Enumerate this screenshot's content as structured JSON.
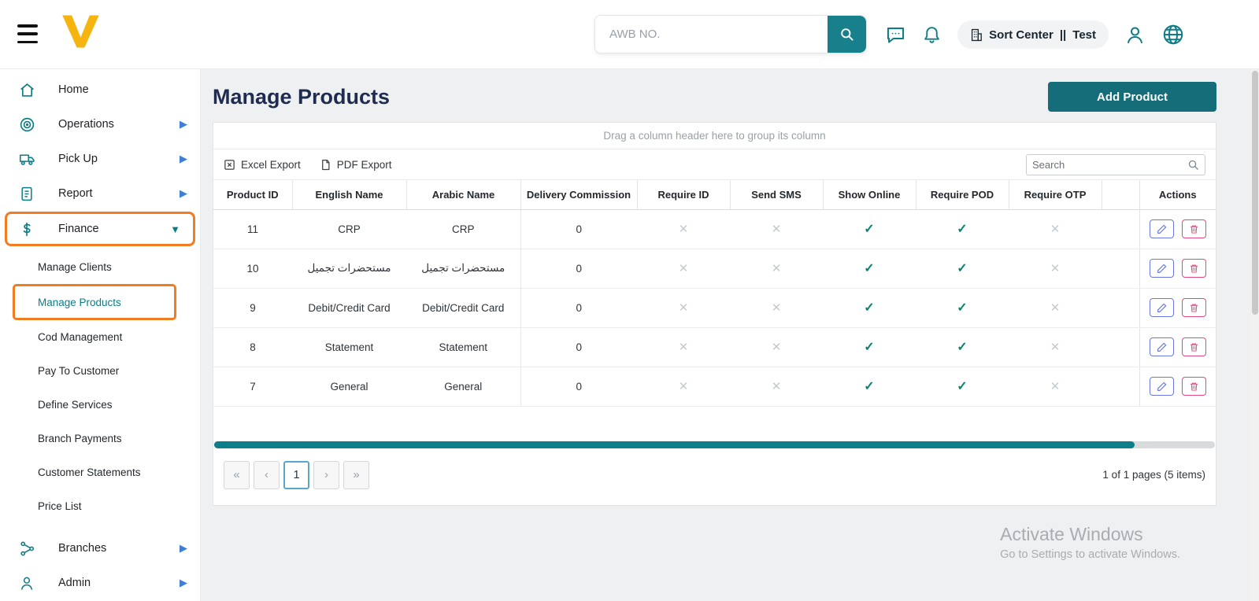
{
  "header": {
    "search": {
      "placeholder": "AWB NO."
    },
    "center_badge": {
      "label": "Sort Center",
      "divider": "||",
      "value": "Test"
    }
  },
  "sidebar": {
    "items": [
      {
        "label": "Home",
        "icon": "home"
      },
      {
        "label": "Operations",
        "icon": "operations"
      },
      {
        "label": "Pick Up",
        "icon": "pickup-truck"
      },
      {
        "label": "Report",
        "icon": "report-document"
      },
      {
        "label": "Finance",
        "icon": "dollar"
      },
      {
        "label": "Branches",
        "icon": "branches-network"
      },
      {
        "label": "Admin",
        "icon": "person"
      }
    ],
    "finance_submenu": [
      {
        "label": "Manage Clients"
      },
      {
        "label": "Manage Products"
      },
      {
        "label": "Cod Management"
      },
      {
        "label": "Pay To Customer"
      },
      {
        "label": "Define Services"
      },
      {
        "label": "Branch Payments"
      },
      {
        "label": "Customer Statements"
      },
      {
        "label": "Price List"
      }
    ]
  },
  "main": {
    "title": "Manage Products",
    "add_product_button": "Add Product",
    "grid": {
      "group_hint": "Drag a column header here to group its column",
      "excel_export_label": "Excel Export",
      "pdf_export_label": "PDF Export",
      "search_placeholder": "Search",
      "columns": [
        "Product ID",
        "English Name",
        "Arabic Name",
        "Delivery Commission",
        "Require ID",
        "Send SMS",
        "Show Online",
        "Require POD",
        "Require OTP",
        "",
        "Actions"
      ],
      "rows": [
        {
          "product_id": "11",
          "english_name": "CRP",
          "arabic_name": "CRP",
          "delivery_commission": "0",
          "require_id": false,
          "send_sms": false,
          "show_online": true,
          "require_pod": true,
          "require_otp": false
        },
        {
          "product_id": "10",
          "english_name": "مستحضرات تجميل",
          "arabic_name": "مستحضرات تجميل",
          "delivery_commission": "0",
          "require_id": false,
          "send_sms": false,
          "show_online": true,
          "require_pod": true,
          "require_otp": false
        },
        {
          "product_id": "9",
          "english_name": "Debit/Credit Card",
          "arabic_name": "Debit/Credit Card",
          "delivery_commission": "0",
          "require_id": false,
          "send_sms": false,
          "show_online": true,
          "require_pod": true,
          "require_otp": false
        },
        {
          "product_id": "8",
          "english_name": "Statement",
          "arabic_name": "Statement",
          "delivery_commission": "0",
          "require_id": false,
          "send_sms": false,
          "show_online": true,
          "require_pod": true,
          "require_otp": false
        },
        {
          "product_id": "7",
          "english_name": "General",
          "arabic_name": "General",
          "delivery_commission": "0",
          "require_id": false,
          "send_sms": false,
          "show_online": true,
          "require_pod": true,
          "require_otp": false
        }
      ]
    },
    "pagination": {
      "first": "«",
      "prev": "‹",
      "page": "1",
      "next": "›",
      "last": "»",
      "summary": "1 of 1 pages (5 items)"
    }
  },
  "watermark": {
    "title": "Activate Windows",
    "subtitle": "Go to Settings to activate Windows."
  }
}
